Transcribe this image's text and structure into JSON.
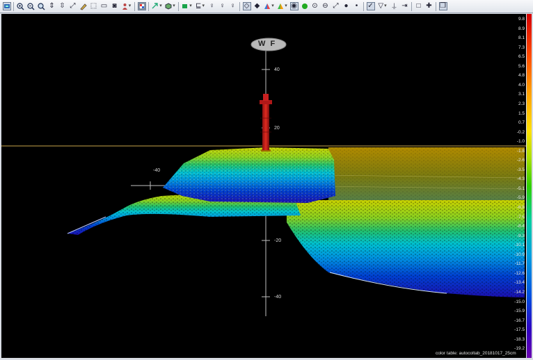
{
  "toolbar": {
    "icons": [
      "layer-icon",
      "zoom-in-icon",
      "zoom-out-icon",
      "zoom-fit-icon",
      "fit-vertical-icon",
      "fit-height-icon",
      "measure-icon",
      "pencil-icon",
      "select-icon",
      "hand-icon",
      "camera-icon",
      "video-icon",
      "person-icon",
      "color-palette-icon",
      "arrow-icon",
      "cube-icon",
      "panel-icon",
      "light-icon",
      "light-icon",
      "light-icon",
      "diamond-icon",
      "triangle-icon",
      "triangle-icon",
      "point-icon",
      "dot-icon",
      "circle-icon",
      "zoom-icon",
      "line-icon",
      "point-small-icon",
      "check-icon",
      "filter-icon",
      "pin-icon",
      "square-icon",
      "crosshair-icon",
      "window-icon"
    ]
  },
  "view": {
    "axis_labels": {
      "v40": "40",
      "v20": "20",
      "vm20": "-20",
      "vm40": "-40",
      "hm40": "-40"
    },
    "compass": {
      "letters": "W F"
    },
    "footer": "color table: autocoltab_20181017_25cm"
  },
  "scale": {
    "labels": [
      "9.8",
      "8.9",
      "8.1",
      "7.3",
      "6.5",
      "5.6",
      "4.8",
      "4.0",
      "3.1",
      "2.3",
      "1.5",
      "0.7",
      "-0.2",
      "-1.0",
      "-1.8",
      "-2.6",
      "-3.5",
      "-4.3",
      "-5.1",
      "-5.9",
      "-6.8",
      "-7.6",
      "-8.4",
      "-9.3",
      "-10.1",
      "-10.9",
      "-11.7",
      "-12.6",
      "-13.4",
      "-14.2",
      "-15.0",
      "-15.9",
      "-16.7",
      "-17.5",
      "-18.3",
      "-19.2"
    ],
    "colors": [
      "#d40000",
      "#ff9a00",
      "#ffe000",
      "#30d000",
      "#00a0e0",
      "#3000c0"
    ]
  }
}
